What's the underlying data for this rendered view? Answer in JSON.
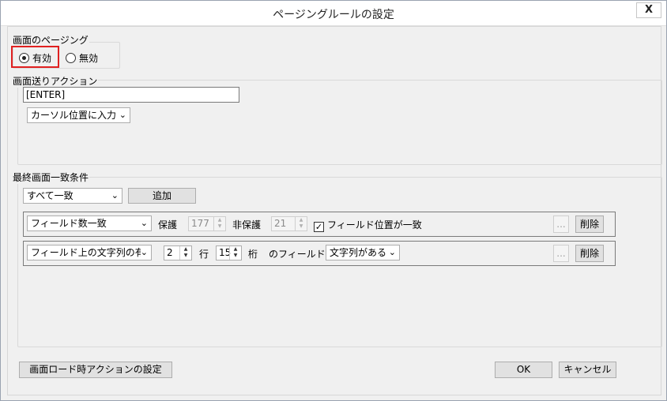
{
  "window": {
    "title": "ページングルールの設定",
    "close_label": "X"
  },
  "paging": {
    "group_label": "画面のページング",
    "enabled_label": "有効",
    "disabled_label": "無効",
    "selected": "有効"
  },
  "action": {
    "group_label": "画面送りアクション",
    "value": "[ENTER]",
    "mode_selected": "カーソル位置に入力"
  },
  "match": {
    "group_label": "最終画面一致条件",
    "mode_selected": "すべて一致",
    "add_button": "追加",
    "rows": [
      {
        "type": "フィールド数一致",
        "protected_label": "保護",
        "protected_value": "177",
        "unprotected_label": "非保護",
        "unprotected_value": "21",
        "position_check_label": "フィールド位置が一致",
        "position_checked": true,
        "dots_label": "...",
        "delete_label": "削除"
      },
      {
        "type": "フィールド上の文字列の有無",
        "row_value": "2",
        "row_label": "行",
        "col_value": "15",
        "col_label": "桁",
        "field_label": "のフィールドに",
        "condition_selected": "文字列がある",
        "dots_label": "...",
        "delete_label": "削除"
      }
    ]
  },
  "footer": {
    "load_action_button": "画面ロード時アクションの設定",
    "ok_button": "OK",
    "cancel_button": "キャンセル"
  }
}
